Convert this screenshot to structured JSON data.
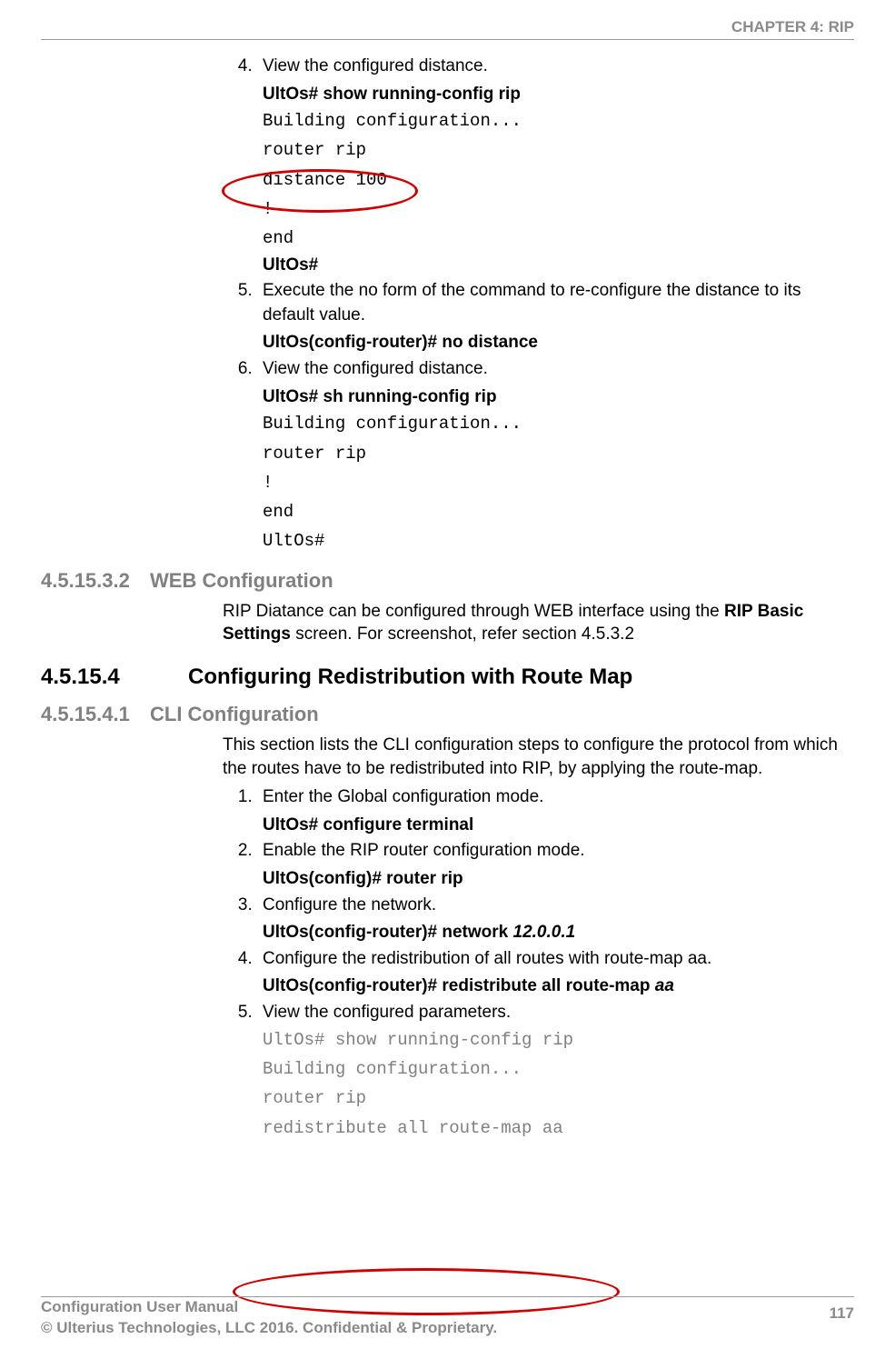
{
  "header": {
    "chapter": "CHAPTER 4: RIP"
  },
  "footer": {
    "left_line1": "Configuration User Manual",
    "left_line2": "© Ulterius Technologies, LLC 2016. Confidential & Proprietary.",
    "page_no": "117"
  },
  "sec_a": {
    "step4": {
      "text": "View the configured distance.",
      "cmd": "UltOs# show running-config rip",
      "out1": "Building configuration...",
      "out2": "router rip",
      "out3": "distance  100",
      "out4": "!",
      "out5": "end",
      "prompt": "UltOs#"
    },
    "step5": {
      "text": "Execute the no form of the command to re-configure the distance to its default value.",
      "cmd": "UltOs(config-router)# no distance"
    },
    "step6": {
      "text": "View the configured distance.",
      "cmd": "UltOs# sh running-config rip",
      "out1": "Building configuration...",
      "out2": "router rip",
      "out3": "!",
      "out4": "end",
      "out5": "UltOs#"
    }
  },
  "h1": {
    "num": "4.5.15.3.2",
    "title": "WEB Configuration"
  },
  "p1": {
    "pre": "RIP Diatance can be configured through WEB interface using the ",
    "bold": "RIP Basic Settings",
    "post": " screen. For screenshot, refer section 4.5.3.2"
  },
  "h2": {
    "num": "4.5.15.4",
    "title": "Configuring Redistribution with Route Map"
  },
  "h3": {
    "num": "4.5.15.4.1",
    "title": "CLI Configuration"
  },
  "p2": "This section lists the CLI configuration steps to configure the protocol from which the routes have to be redistributed into RIP, by applying the route-map.",
  "sec_b": {
    "step1": {
      "text": "Enter the Global configuration mode.",
      "cmd": "UltOs# configure terminal"
    },
    "step2": {
      "text": "Enable the RIP router configuration mode.",
      "cmd": "UltOs(config)# router rip"
    },
    "step3": {
      "text": "Configure the network.",
      "cmd_pre": "UltOs(config-router)# network ",
      "cmd_it": "12.0.0.1"
    },
    "step4": {
      "text": "Configure the redistribution of all routes with route-map aa.",
      "cmd_pre": "UltOs(config-router)# redistribute all route-map ",
      "cmd_it": "aa"
    },
    "step5": {
      "text": "View the configured parameters.",
      "out1": "UltOs# show running-config rip",
      "out2": "Building configuration...",
      "out3": "router rip",
      "out4": " redistribute all route-map aa"
    }
  }
}
